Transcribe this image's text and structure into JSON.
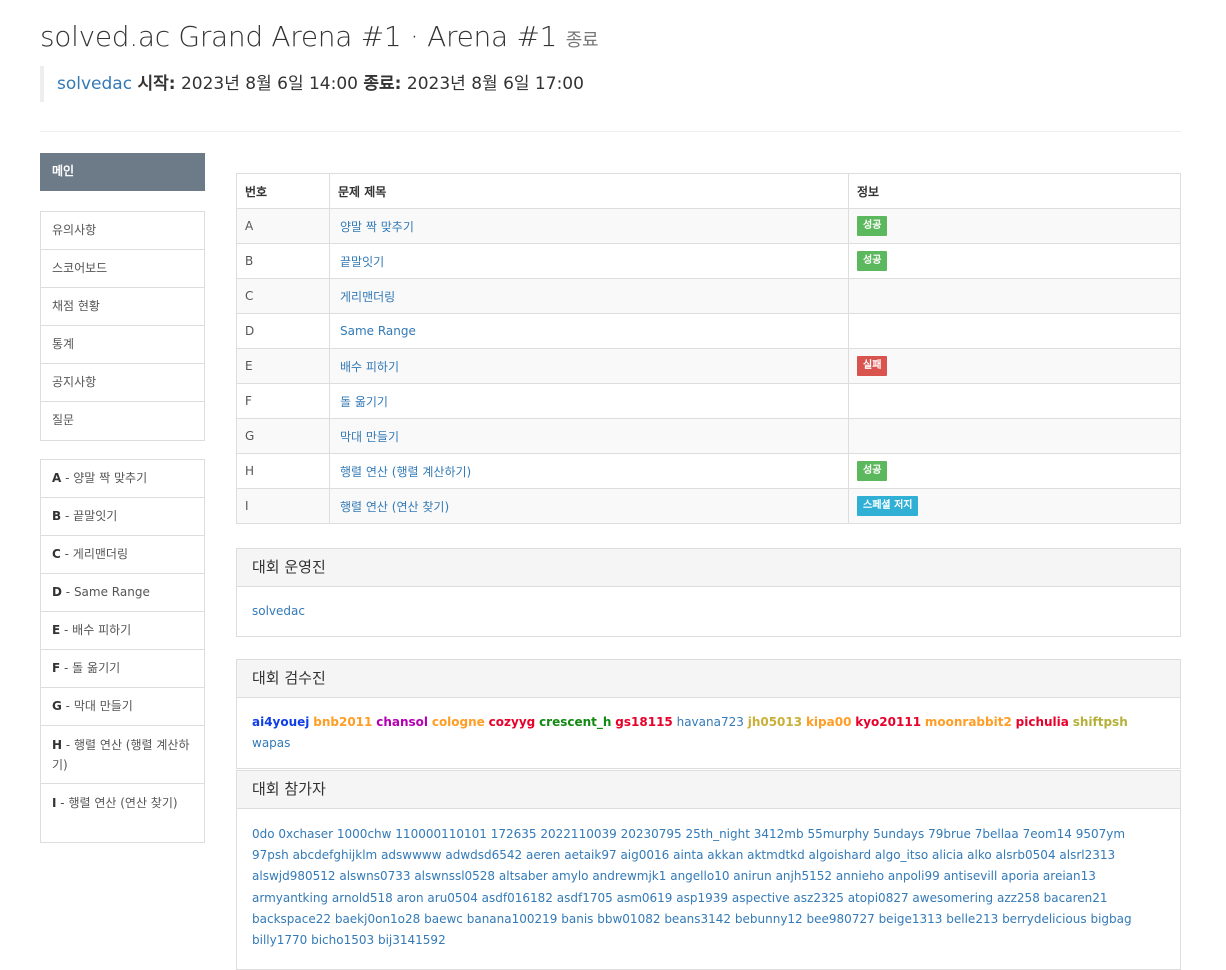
{
  "header": {
    "title": "solved.ac Grand Arena #1 · Arena #1",
    "status": "종료",
    "owner": "solvedac",
    "start_label": "시작:",
    "start_value": "2023년 8월 6일 14:00",
    "end_label": "종료:",
    "end_value": "2023년 8월 6일 17:00"
  },
  "sidebar": {
    "main_label": "메인",
    "menu": [
      "유의사항",
      "스코어보드",
      "채점 현황",
      "통계",
      "공지사항",
      "질문"
    ],
    "problems": [
      {
        "id": "A",
        "title": "양말 짝 맞추기"
      },
      {
        "id": "B",
        "title": "끝말잇기"
      },
      {
        "id": "C",
        "title": "게리맨더링"
      },
      {
        "id": "D",
        "title": "Same Range"
      },
      {
        "id": "E",
        "title": "배수 피하기"
      },
      {
        "id": "F",
        "title": "돌 옮기기"
      },
      {
        "id": "G",
        "title": "막대 만들기"
      },
      {
        "id": "H",
        "title": "행렬 연산 (행렬 계산하기)"
      },
      {
        "id": "I",
        "title": "행렬 연산 (연산 찾기)"
      }
    ]
  },
  "problem_table": {
    "headers": [
      "번호",
      "문제 제목",
      "정보"
    ],
    "rows": [
      {
        "id": "A",
        "title": "양말 짝 맞추기",
        "badge": "성공",
        "badge_color": "#5cb85c"
      },
      {
        "id": "B",
        "title": "끝말잇기",
        "badge": "성공",
        "badge_color": "#5cb85c"
      },
      {
        "id": "C",
        "title": "게리맨더링",
        "badge": "",
        "badge_color": ""
      },
      {
        "id": "D",
        "title": "Same Range",
        "badge": "",
        "badge_color": ""
      },
      {
        "id": "E",
        "title": "배수 피하기",
        "badge": "실패",
        "badge_color": "#d9534f"
      },
      {
        "id": "F",
        "title": "돌 옮기기",
        "badge": "",
        "badge_color": ""
      },
      {
        "id": "G",
        "title": "막대 만들기",
        "badge": "",
        "badge_color": ""
      },
      {
        "id": "H",
        "title": "행렬 연산 (행렬 계산하기)",
        "badge": "성공",
        "badge_color": "#5cb85c"
      },
      {
        "id": "I",
        "title": "행렬 연산 (연산 찾기)",
        "badge": "스페셜 저지",
        "badge_color": "#31b0d5"
      }
    ]
  },
  "organizers": {
    "heading": "대회 운영진",
    "names": [
      "solvedac"
    ]
  },
  "reviewers": {
    "heading": "대회 검수진",
    "names": [
      {
        "name": "ai4youej",
        "color": "#0f3ee8",
        "bold": true
      },
      {
        "name": "bnb2011",
        "color": "#ff9d24",
        "bold": true
      },
      {
        "name": "chansol",
        "color": "#b300b3",
        "bold": true
      },
      {
        "name": "cologne",
        "color": "#ff9d24",
        "bold": true
      },
      {
        "name": "cozyyg",
        "color": "#e8002b",
        "bold": true
      },
      {
        "name": "crescent_h",
        "color": "#128a12",
        "bold": true
      },
      {
        "name": "gs18115",
        "color": "#e8002b",
        "bold": true
      },
      {
        "name": "havana723",
        "color": "#337ab7",
        "bold": false
      },
      {
        "name": "jh05013",
        "color": "#c9b037",
        "bold": true
      },
      {
        "name": "kipa00",
        "color": "#ff9d24",
        "bold": true
      },
      {
        "name": "kyo20111",
        "color": "#e8002b",
        "bold": true
      },
      {
        "name": "moonrabbit2",
        "color": "#ff9d24",
        "bold": true
      },
      {
        "name": "pichulia",
        "color": "#e8002b",
        "bold": true
      },
      {
        "name": "shiftpsh",
        "color": "#b5b03a",
        "bold": true
      },
      {
        "name": "wapas",
        "color": "#337ab7",
        "bold": false
      }
    ]
  },
  "participants": {
    "heading": "대회 참가자",
    "names": [
      "0do",
      "0xchaser",
      "1000chw",
      "110000110101",
      "172635",
      "2022110039",
      "20230795",
      "25th_night",
      "3412mb",
      "55murphy",
      "5undays",
      "79brue",
      "7bellaa",
      "7eom14",
      "9507ym",
      "97psh",
      "abcdefghijklm",
      "adswwww",
      "adwdsd6542",
      "aeren",
      "aetaik97",
      "aig0016",
      "ainta",
      "akkan",
      "aktmdtkd",
      "algoishard",
      "algo_itso",
      "alicia",
      "alko",
      "alsrb0504",
      "alsrl2313",
      "alswjd980512",
      "alswns0733",
      "alswnssl0528",
      "altsaber",
      "amylo",
      "andrewmjk1",
      "angello10",
      "anirun",
      "anjh5152",
      "annieho",
      "anpoli99",
      "antisevill",
      "aporia",
      "areian13",
      "armyantking",
      "arnold518",
      "aron",
      "aru0504",
      "asdf016182",
      "asdf1705",
      "asm0619",
      "asp1939",
      "aspective",
      "asz2325",
      "atopi0827",
      "awesomering",
      "azz258",
      "bacaren21",
      "backspace22",
      "baekj0on1o28",
      "baewc",
      "banana100219",
      "banis",
      "bbw01082",
      "beans3142",
      "bebunny12",
      "bee980727",
      "beige1313",
      "belle213",
      "berrydelicious",
      "bigbag",
      "billy1770",
      "bicho1503",
      "bij3141592"
    ]
  }
}
